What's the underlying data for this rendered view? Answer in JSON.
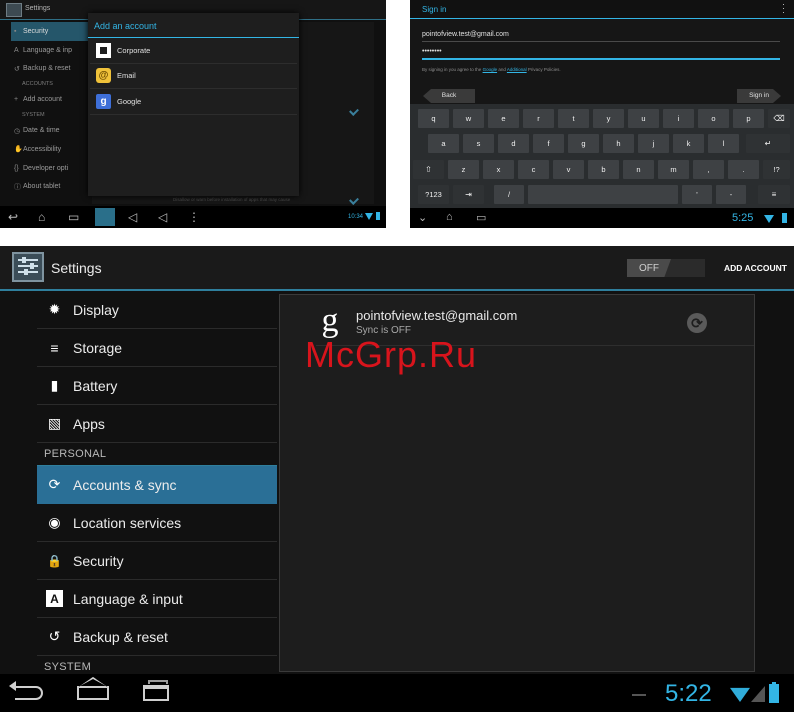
{
  "shot_a": {
    "title": "Settings",
    "menu": [
      {
        "label": "Security",
        "icon": "lock-icon",
        "selected": true
      },
      {
        "label": "Language & inp",
        "icon": "language-icon"
      },
      {
        "label": "Backup & reset",
        "icon": "backup-icon"
      }
    ],
    "accounts_header": "ACCOUNTS",
    "add_account": "Add account",
    "system_header": "SYSTEM",
    "system_items": [
      {
        "label": "Date & time",
        "icon": "clock-icon"
      },
      {
        "label": "Accessibility",
        "icon": "accessibility-icon"
      },
      {
        "label": "Developer opti",
        "icon": "developer-icon"
      },
      {
        "label": "About tablet",
        "icon": "info-icon"
      }
    ],
    "bottom_note": "Disallow or warn before installation of apps that may cause",
    "dialog": {
      "title": "Add an account",
      "options": [
        {
          "label": "Corporate",
          "icon": "corporate-icon"
        },
        {
          "label": "Email",
          "icon": "email-icon",
          "glyph": "@"
        },
        {
          "label": "Google",
          "icon": "google-icon",
          "glyph": "g"
        }
      ]
    },
    "time": "10:34",
    "accent": "#33b5e5"
  },
  "shot_b": {
    "header": "Sign in",
    "email_value": "pointofview.test@gmail.com",
    "password_value": "••••••••",
    "agree_text": "By signing in you agree to the",
    "agree_link1": "Google",
    "agree_mid": "and",
    "agree_link2": "Additional",
    "agree_end": "Privacy Policies.",
    "back_label": "Back",
    "signin_label": "Sign in",
    "keys_row1": [
      "q",
      "w",
      "e",
      "r",
      "t",
      "y",
      "u",
      "i",
      "o",
      "p"
    ],
    "keys_row2": [
      "a",
      "s",
      "d",
      "f",
      "g",
      "h",
      "j",
      "k",
      "l"
    ],
    "keys_row3": [
      "z",
      "x",
      "c",
      "v",
      "b",
      "n",
      "m",
      ",",
      ".",
      "!?"
    ],
    "key_backspace": "⌫",
    "key_enter": "↵",
    "key_shift": "⇧",
    "key_123": "?123",
    "key_tab": "⇥",
    "key_slash": "/",
    "key_apos": "'",
    "key_dash": "-",
    "key_settings": "≡",
    "time": "5:25"
  },
  "shot_c": {
    "title": "Settings",
    "toggle_label": "OFF",
    "add_account": "ADD ACCOUNT",
    "device_items": [
      {
        "label": "Display",
        "icon": "display-icon",
        "glyph": "✹"
      },
      {
        "label": "Storage",
        "icon": "storage-icon",
        "glyph": "≡"
      },
      {
        "label": "Battery",
        "icon": "battery-icon",
        "glyph": "▮"
      },
      {
        "label": "Apps",
        "icon": "apps-icon",
        "glyph": "▧"
      }
    ],
    "personal_header": "PERSONAL",
    "personal_items": [
      {
        "label": "Accounts & sync",
        "icon": "sync-icon",
        "glyph": "⟳",
        "selected": true
      },
      {
        "label": "Location services",
        "icon": "location-icon",
        "glyph": "◉"
      },
      {
        "label": "Security",
        "icon": "lock-icon",
        "glyph": "🔒"
      },
      {
        "label": "Language & input",
        "icon": "language-icon",
        "glyph": "A"
      },
      {
        "label": "Backup & reset",
        "icon": "backup-icon",
        "glyph": "↺"
      }
    ],
    "system_header": "SYSTEM",
    "account": {
      "email": "pointofview.test@gmail.com",
      "status": "Sync is OFF",
      "glyph": "g"
    },
    "watermark": "McGrp.Ru",
    "time": "5:22",
    "accent": "#33b5e5",
    "selected_color": "#2a6f96"
  }
}
